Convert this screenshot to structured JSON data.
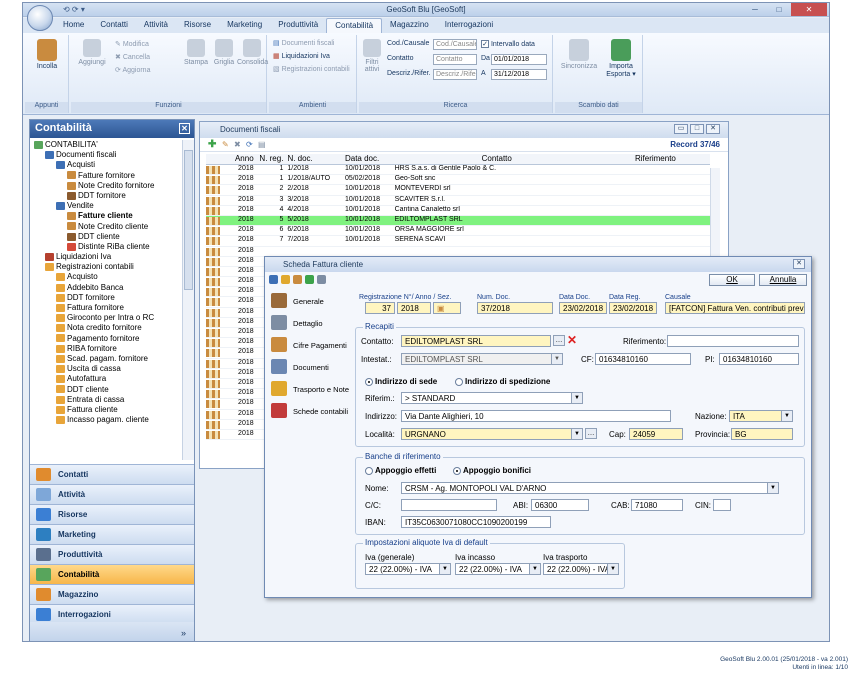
{
  "window": {
    "title": "GeoSoft Blu [GeoSoft]",
    "qat": "⟲ ⟳ ▾"
  },
  "tabs": [
    "Home",
    "Contatti",
    "Attività",
    "Risorse",
    "Marketing",
    "Produttività",
    "Contabilità",
    "Magazzino",
    "Interrogazioni"
  ],
  "ribbon": {
    "appunti": {
      "label": "Appunti",
      "incolla": "Incolla"
    },
    "funzioni": {
      "label": "Funzioni",
      "modifica": "Modifica",
      "aggiungi": "Aggiungi",
      "cancella": "Cancella",
      "aggiorna": "Aggiorna",
      "stampa": "Stampa",
      "griglia": "Griglia",
      "consolida": "Consolida"
    },
    "ambienti": {
      "label": "Ambienti",
      "documenti_fiscali": "Documenti fiscali",
      "liquidazioni_iva": "Liquidazioni Iva",
      "registrazioni_contabili": "Registrazioni contabili"
    },
    "ricerca": {
      "label": "Ricerca",
      "filtri": "Filtri attivi",
      "cod_causale_label": "Cod./Causale",
      "cod_causale_placeholder": "Cod./Causale",
      "intervallo": "Intervallo data",
      "contatto_label": "Contatto",
      "contatto_placeholder": "Contatto",
      "da_label": "Da",
      "da_value": "01/01/2018",
      "descr_label": "Descriz./Rifer.",
      "descr_placeholder": "Descriz./Rifer",
      "a_label": "A",
      "a_value": "31/12/2018"
    },
    "scambio": {
      "label": "Scambio dati",
      "sincronizza": "Sincronizza",
      "importa": "Importa",
      "esporta": "Esporta ▾"
    }
  },
  "nav": {
    "title": "Contabilità",
    "tree": [
      {
        "label": "CONTABILITA'",
        "indent": 0,
        "color": "#58a55c"
      },
      {
        "label": "Documenti fiscali",
        "indent": 1,
        "color": "#3d6fb5"
      },
      {
        "label": "Acquisti",
        "indent": 2,
        "color": "#3d6fb5"
      },
      {
        "label": "Fatture fornitore",
        "indent": 3,
        "color": "#c98b3f"
      },
      {
        "label": "Note Credito fornitore",
        "indent": 3,
        "color": "#c98b3f"
      },
      {
        "label": "DDT fornitore",
        "indent": 3,
        "color": "#8a5a2e"
      },
      {
        "label": "Vendite",
        "indent": 2,
        "color": "#3d6fb5"
      },
      {
        "label": "Fatture cliente",
        "indent": 3,
        "color": "#c98b3f",
        "bold": true
      },
      {
        "label": "Note Credito cliente",
        "indent": 3,
        "color": "#c98b3f"
      },
      {
        "label": "DDT cliente",
        "indent": 3,
        "color": "#8a5a2e"
      },
      {
        "label": "Distinte RiBa cliente",
        "indent": 3,
        "color": "#d44a3a"
      },
      {
        "label": "Liquidazioni Iva",
        "indent": 1,
        "color": "#b5402e"
      },
      {
        "label": "Registrazioni contabili",
        "indent": 1,
        "color": "#e8a53a"
      },
      {
        "label": "Acquisto",
        "indent": 2,
        "color": "#e8a53a"
      },
      {
        "label": "Addebito Banca",
        "indent": 2,
        "color": "#e8a53a"
      },
      {
        "label": "DDT fornitore",
        "indent": 2,
        "color": "#e8a53a"
      },
      {
        "label": "Fattura fornitore",
        "indent": 2,
        "color": "#e8a53a"
      },
      {
        "label": "Giroconto per Intra o RC",
        "indent": 2,
        "color": "#e8a53a"
      },
      {
        "label": "Nota credito fornitore",
        "indent": 2,
        "color": "#e8a53a"
      },
      {
        "label": "Pagamento fornitore",
        "indent": 2,
        "color": "#e8a53a"
      },
      {
        "label": "RIBA fornitore",
        "indent": 2,
        "color": "#e8a53a"
      },
      {
        "label": "Scad. pagam. fornitore",
        "indent": 2,
        "color": "#e8a53a"
      },
      {
        "label": "Uscita di cassa",
        "indent": 2,
        "color": "#e8a53a"
      },
      {
        "label": "Autofattura",
        "indent": 2,
        "color": "#e8a53a"
      },
      {
        "label": "DDT cliente",
        "indent": 2,
        "color": "#e8a53a"
      },
      {
        "label": "Entrata di cassa",
        "indent": 2,
        "color": "#e8a53a"
      },
      {
        "label": "Fattura cliente",
        "indent": 2,
        "color": "#e8a53a"
      },
      {
        "label": "Incasso pagam. cliente",
        "indent": 2,
        "color": "#e8a53a"
      }
    ],
    "buttons": [
      {
        "label": "Contatti",
        "color": "#e08b2e",
        "active": false
      },
      {
        "label": "Attività",
        "color": "#7ea7d8",
        "active": false
      },
      {
        "label": "Risorse",
        "color": "#3b7fd4",
        "active": false
      },
      {
        "label": "Marketing",
        "color": "#2d7fc1",
        "active": false
      },
      {
        "label": "Produttività",
        "color": "#5a6f8e",
        "active": false
      },
      {
        "label": "Contabilità",
        "color": "#58a55c",
        "active": true
      },
      {
        "label": "Magazzino",
        "color": "#e08b2e",
        "active": false
      },
      {
        "label": "Interrogazioni",
        "color": "#3b7fd4",
        "active": false
      }
    ],
    "footer": "»"
  },
  "docs": {
    "title": "Documenti fiscali",
    "record": "Record 37/46",
    "columns": [
      "Anno",
      "N. reg.",
      "N. doc.",
      "Data doc.",
      "Contatto",
      "Riferimento"
    ],
    "rows": [
      [
        "2018",
        "1",
        "1/2018",
        "10/01/2018",
        "HRS S.a.s. di Gentile Paolo & C.",
        ""
      ],
      [
        "2018",
        "1",
        "1/2018/AUTO",
        "05/02/2018",
        "Geo-Soft snc",
        ""
      ],
      [
        "2018",
        "2",
        "2/2018",
        "10/01/2018",
        "MONTEVERDI srl",
        ""
      ],
      [
        "2018",
        "3",
        "3/2018",
        "10/01/2018",
        "SCAVITER S.r.l.",
        ""
      ],
      [
        "2018",
        "4",
        "4/2018",
        "10/01/2018",
        "Cantina Canaletto srl",
        ""
      ],
      [
        "2018",
        "5",
        "5/2018",
        "10/01/2018",
        "EDILTOMPLAST SRL",
        ""
      ],
      [
        "2018",
        "6",
        "6/2018",
        "10/01/2018",
        "ORSA MAGGIORE srl",
        ""
      ],
      [
        "2018",
        "7",
        "7/2018",
        "10/01/2018",
        "SERENA SCAVI",
        ""
      ],
      [
        "2018",
        "",
        "",
        "",
        "",
        ""
      ],
      [
        "2018",
        "",
        "",
        "",
        "",
        ""
      ],
      [
        "2018",
        "",
        "",
        "",
        "",
        ""
      ],
      [
        "2018",
        "",
        "",
        "",
        "",
        ""
      ],
      [
        "2018",
        "",
        "",
        "",
        "",
        ""
      ],
      [
        "2018",
        "",
        "",
        "",
        "",
        ""
      ],
      [
        "2018",
        "",
        "",
        "",
        "",
        ""
      ],
      [
        "2018",
        "",
        "",
        "",
        "",
        ""
      ],
      [
        "2018",
        "",
        "",
        "",
        "",
        ""
      ],
      [
        "2018",
        "",
        "",
        "",
        "",
        ""
      ],
      [
        "2018",
        "",
        "",
        "",
        "",
        ""
      ],
      [
        "2018",
        "",
        "",
        "",
        "",
        ""
      ],
      [
        "2018",
        "",
        "",
        "",
        "",
        ""
      ],
      [
        "2018",
        "",
        "",
        "",
        "",
        ""
      ],
      [
        "2018",
        "",
        "",
        "",
        "",
        ""
      ],
      [
        "2018",
        "",
        "",
        "",
        "",
        ""
      ],
      [
        "2018",
        "",
        "",
        "",
        "",
        ""
      ],
      [
        "2018",
        "",
        "",
        "",
        "",
        ""
      ],
      [
        "2018",
        "",
        "",
        "",
        "",
        ""
      ]
    ],
    "selected_row": 5
  },
  "dialog": {
    "title": "Scheda Fattura cliente",
    "ok": "OK",
    "annulla": "Annulla",
    "menu": [
      {
        "label": "Generale",
        "color": "#9a6a3a"
      },
      {
        "label": "Dettaglio",
        "color": "#7d8da3"
      },
      {
        "label": "Cifre Pagamenti",
        "color": "#c98b3f"
      },
      {
        "label": "Documenti",
        "color": "#6b87b2"
      },
      {
        "label": "Trasporto e Note",
        "color": "#e0a82e"
      },
      {
        "label": "Schede contabili",
        "color": "#c23b3b"
      }
    ],
    "header": {
      "reg_label": "Registrazione N°/ Anno / Sez.",
      "reg_num": "37",
      "reg_anno": "2018",
      "numdoc_label": "Num. Doc.",
      "numdoc": "37/2018",
      "datadoc_label": "Data Doc.",
      "datadoc": "23/02/2018",
      "datareg_label": "Data Reg.",
      "datareg": "23/02/2018",
      "causale_label": "Causale",
      "causale": "[FATCON] Fattura Ven. contributi previde"
    },
    "recapiti": {
      "title": "Recapiti",
      "contatto_label": "Contatto:",
      "contatto": "EDILTOMPLAST SRL",
      "riferimento_label": "Riferimento:",
      "riferimento": "",
      "intestat_label": "Intestat.:",
      "intestat": "EDILTOMPLAST SRL",
      "cf_label": "CF:",
      "cf": "01634810160",
      "pi_label": "PI:",
      "pi": "01634810160",
      "sede": "Indirizzo di sede",
      "spedizione": "Indirizzo di spedizione",
      "riferim_label": "Riferim.:",
      "riferim": "> STANDARD",
      "indirizzo_label": "Indirizzo:",
      "indirizzo": "Via Dante Alighieri, 10",
      "nazione_label": "Nazione:",
      "nazione": "ITA",
      "localita_label": "Località:",
      "localita": "URGNANO",
      "cap_label": "Cap:",
      "cap": "24059",
      "provincia_label": "Provincia:",
      "provincia": "BG"
    },
    "banche": {
      "title": "Banche di riferimento",
      "effetti": "Appoggio effetti",
      "bonifici": "Appoggio bonifici",
      "nome_label": "Nome:",
      "nome": "CRSM - Ag. MONTOPOLI VAL D'ARNO",
      "cc_label": "C/C:",
      "cc": "",
      "abi_label": "ABI:",
      "abi": "06300",
      "cab_label": "CAB:",
      "cab": "71080",
      "cin_label": "CIN:",
      "cin": "",
      "iban_label": "IBAN:",
      "iban": "IT35C0630071080CC1090200199"
    },
    "iva": {
      "title": "Impostazioni aliquote Iva di default",
      "generale_label": "Iva (generale)",
      "generale": "22 (22.00%) - IVA",
      "incasso_label": "Iva incasso",
      "incasso": "22 (22.00%) - IVA",
      "trasporto_label": "Iva trasporto",
      "trasporto": "22 (22.00%) - IVA"
    }
  },
  "status": {
    "line1": "GeoSoft Blu 2.00.01 (25/01/2018 - va 2.001)",
    "line2": "Utenti in linea: 1/10"
  }
}
